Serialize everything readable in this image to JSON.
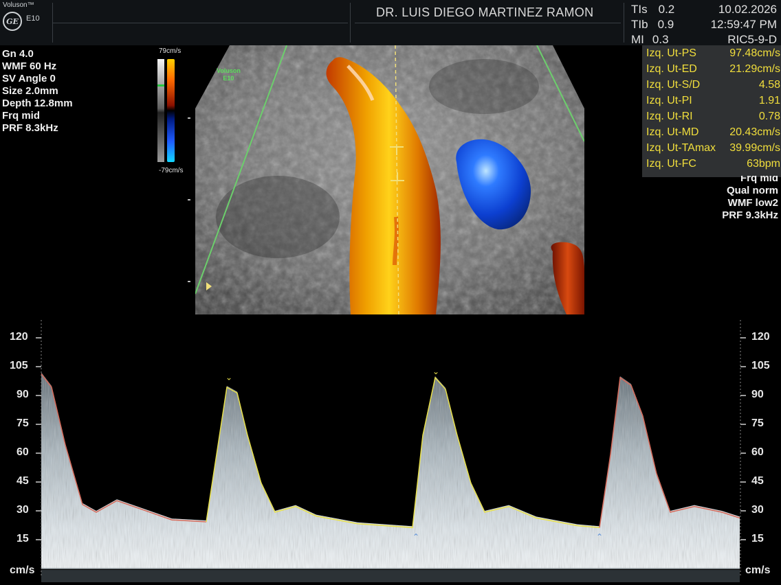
{
  "header": {
    "brand": "Voluson™",
    "model": "E10",
    "logo_text": "GE",
    "doctor": "DR. LUIS DIEGO MARTINEZ RAMON",
    "indices": [
      {
        "label": "TIs",
        "value": "0.2"
      },
      {
        "label": "TIb",
        "value": "0.9"
      },
      {
        "label": "MI",
        "value": "0.3"
      }
    ],
    "date": "10.02.2026",
    "time": "12:59:47 PM",
    "probe": "RIC5-9-D"
  },
  "left_params": [
    "Gn  4.0",
    "WMF 60 Hz",
    "SV Angle  0",
    "Size  2.0mm",
    "Depth 12.8mm",
    "Frq mid",
    "PRF  8.3kHz"
  ],
  "colorbar": {
    "top_label": "79cm/s",
    "bottom_label": "-79cm/s"
  },
  "image": {
    "watermark_line1": "Voluson",
    "watermark_line2": "E10"
  },
  "measurements": [
    {
      "label": "Izq. Ut-PS",
      "value": "97.48cm/s"
    },
    {
      "label": "Izq. Ut-ED",
      "value": "21.29cm/s"
    },
    {
      "label": "Izq. Ut-S/D",
      "value": "4.58"
    },
    {
      "label": "Izq. Ut-PI",
      "value": "1.91"
    },
    {
      "label": "Izq. Ut-RI",
      "value": "0.78"
    },
    {
      "label": "Izq. Ut-MD",
      "value": "20.43cm/s"
    },
    {
      "label": "Izq. Ut-TAmax",
      "value": "39.99cm/s"
    },
    {
      "label": "Izq. Ut-FC",
      "value": "63bpm"
    }
  ],
  "right_params": [
    "Frq mid",
    "Qual norm",
    "WMF low2",
    "PRF  9.3kHz"
  ],
  "spectral": {
    "unit": "cm/s",
    "ticks": [
      "120",
      "105",
      "90",
      "75",
      "60",
      "45",
      "30",
      "15"
    ],
    "colors": {
      "envelope_auto": "#e8e04a",
      "envelope_trace": "#d66a5a",
      "marker": "#5a8fd8"
    }
  }
}
